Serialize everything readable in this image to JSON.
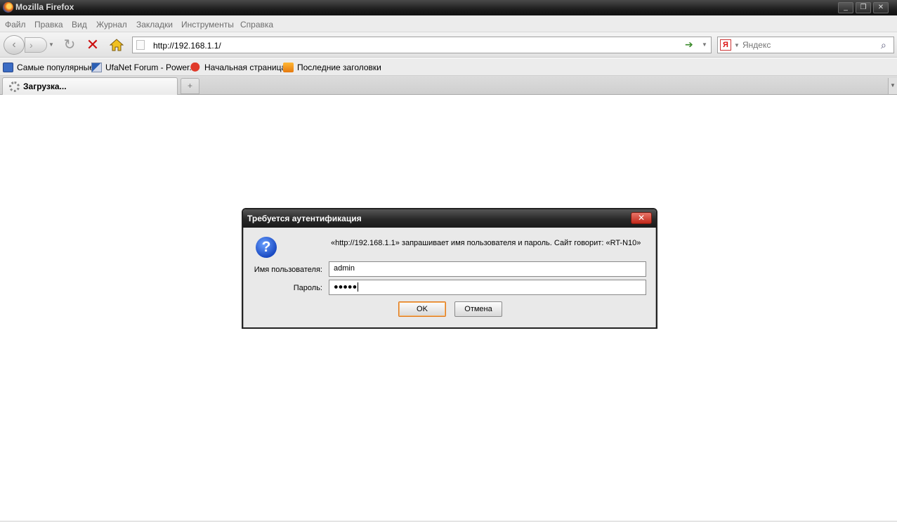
{
  "window": {
    "title": "Mozilla Firefox",
    "min": "_",
    "max": "❐",
    "close": "✕"
  },
  "menu": [
    "Файл",
    "Правка",
    "Вид",
    "Журнал",
    "Закладки",
    "Инструменты",
    "Справка"
  ],
  "nav": {
    "url": "http://192.168.1.1/",
    "search_placeholder": "Яндекс",
    "search_engine": "Я"
  },
  "bookmarks": [
    {
      "label": "Самые популярные",
      "icon": "popular-bookmarks-icon"
    },
    {
      "label": "UfaNet Forum - Power...",
      "icon": "ufanet-favicon-icon"
    },
    {
      "label": "Начальная страница",
      "icon": "start-page-icon"
    },
    {
      "label": "Последние заголовки",
      "icon": "rss-feed-icon"
    }
  ],
  "tabs": [
    {
      "label": "Загрузка..."
    }
  ],
  "dialog": {
    "title": "Требуется аутентификация",
    "message": "«http://192.168.1.1» запрашивает имя пользователя и пароль. Сайт говорит: «RT-N10»",
    "username_label": "Имя пользователя:",
    "username_value": "admin",
    "password_label": "Пароль:",
    "password_value": "●●●●●",
    "ok_label": "OK",
    "cancel_label": "Отмена",
    "close_glyph": "✕",
    "question_glyph": "?"
  }
}
